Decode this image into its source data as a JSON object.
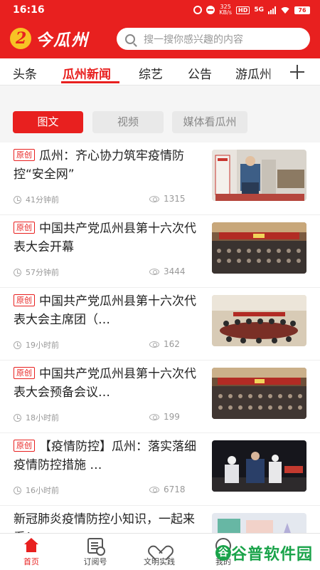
{
  "status_bar": {
    "time": "16:16",
    "speed": "325\nKB/s",
    "hd": "HD",
    "network": "5G",
    "battery": "76"
  },
  "header": {
    "logo_text": "今瓜州",
    "search_placeholder": "搜一搜你感兴趣的内容"
  },
  "tabs": [
    {
      "label": "头条"
    },
    {
      "label": "瓜州新闻",
      "active": true
    },
    {
      "label": "综艺"
    },
    {
      "label": "公告"
    },
    {
      "label": "游瓜州"
    }
  ],
  "subtabs": [
    {
      "label": "图文",
      "active": true
    },
    {
      "label": "视频"
    },
    {
      "label": "媒体看瓜州"
    }
  ],
  "badge_label": "原创",
  "news": [
    {
      "original": true,
      "title": "瓜州：齐心协力筑牢疫情防控“安全网”",
      "time": "41分钟前",
      "views": "1315",
      "thumb": "checkpoint"
    },
    {
      "original": true,
      "title": "中国共产党瓜州县第十六次代表大会开幕",
      "time": "57分钟前",
      "views": "3444",
      "thumb": "hall"
    },
    {
      "original": true,
      "title": "中国共产党瓜州县第十六次代表大会主席团（…",
      "time": "19小时前",
      "views": "162",
      "thumb": "meeting"
    },
    {
      "original": true,
      "title": "中国共产党瓜州县第十六次代表大会预备会议…",
      "time": "18小时前",
      "views": "199",
      "thumb": "hall"
    },
    {
      "original": true,
      "title": "【疫情防控】瓜州：落实落细疫情防控措施 …",
      "time": "16小时前",
      "views": "6718",
      "thumb": "night"
    },
    {
      "original": false,
      "title": "新冠肺炎疫情防控小知识，一起来看！",
      "time": "",
      "views": "",
      "thumb": "cartoon"
    }
  ],
  "bottom_nav": [
    {
      "label": "首页",
      "icon": "home-icon",
      "active": true
    },
    {
      "label": "订阅号",
      "icon": "subscription-icon"
    },
    {
      "label": "文明实践",
      "icon": "heart-icon"
    },
    {
      "label": "我的",
      "icon": "profile-icon"
    }
  ],
  "watermark": {
    "circle": "谷",
    "text": "谷普软件园"
  },
  "colors": {
    "brand_red": "#e8201f",
    "muted": "#999999"
  }
}
